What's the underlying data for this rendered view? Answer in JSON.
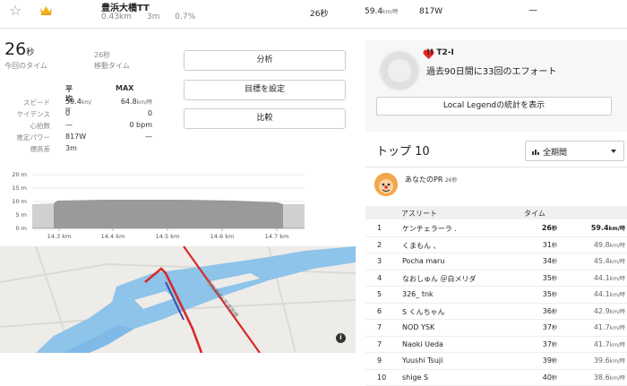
{
  "segment": {
    "name": "豊浜大橋TT",
    "distance": "0.43km",
    "elevation": "3m",
    "grade": "0.7%",
    "time": "26秒",
    "speed_value": "59.4",
    "speed_unit": "km/時",
    "power": "817W",
    "dash": "—"
  },
  "summary": {
    "time_value": "26",
    "time_unit": "秒",
    "time_label": "今回のタイム",
    "moving_time": "26秒",
    "moving_label": "移動タイム"
  },
  "stats": {
    "header_avg": "平均",
    "header_max": "MAX",
    "rows": [
      {
        "label": "スピード",
        "avg": "59.4km/時",
        "max": "64.8km/時"
      },
      {
        "label": "ケイデンス",
        "avg": "0",
        "max": "0"
      },
      {
        "label": "心拍数",
        "avg": "—",
        "max": "0 bpm"
      },
      {
        "label": "推定パワー",
        "avg": "817W",
        "max": "—"
      },
      {
        "label": "標高差",
        "avg": "3m",
        "max": ""
      }
    ]
  },
  "buttons": {
    "analyze": "分析",
    "set_goal": "目標を設定",
    "compare": "比較"
  },
  "elevation_chart": {
    "y_ticks": [
      "20 m",
      "15 m",
      "10 m",
      "5 m",
      "0 m"
    ],
    "x_ticks": [
      "14.3 km",
      "14.4 km",
      "14.5 km",
      "14.6 km",
      "14.7 km"
    ]
  },
  "map": {
    "info_icon": "info-icon",
    "road_label": "阪神高速5号湾岸線"
  },
  "local_legend": {
    "name": "!! T2-I",
    "efforts": "過去90日間に33回のエフォート",
    "stats_button": "Local Legendの統計を表示"
  },
  "leaderboard": {
    "title": "トップ 10",
    "period": "全期間",
    "pr_label": "あなたのPR",
    "pr_time": "26秒",
    "header_athlete": "アスリート",
    "header_time": "タイム",
    "rows": [
      {
        "rank": "1",
        "name": "ケンチェラーラ .",
        "time": "26",
        "unit": "秒",
        "speed": "59.4",
        "speed_unit": "km/時"
      },
      {
        "rank": "2",
        "name": "くまもん 、",
        "time": "31",
        "unit": "秒",
        "speed": "49.8",
        "speed_unit": "km/時"
      },
      {
        "rank": "3",
        "name": "Pocha maru",
        "time": "34",
        "unit": "秒",
        "speed": "45.4",
        "speed_unit": "km/時"
      },
      {
        "rank": "4",
        "name": "なおしゅん ＠白メリダ",
        "time": "35",
        "unit": "秒",
        "speed": "44.1",
        "speed_unit": "km/時"
      },
      {
        "rank": "5",
        "name": "326_ tnk",
        "time": "35",
        "unit": "秒",
        "speed": "44.1",
        "speed_unit": "km/時"
      },
      {
        "rank": "6",
        "name": "S くんちゃん",
        "time": "36",
        "unit": "秒",
        "speed": "42.9",
        "speed_unit": "km/時"
      },
      {
        "rank": "7",
        "name": "NOD YSK",
        "time": "37",
        "unit": "秒",
        "speed": "41.7",
        "speed_unit": "km/時"
      },
      {
        "rank": "7",
        "name": "Naoki Ueda",
        "time": "37",
        "unit": "秒",
        "speed": "41.7",
        "speed_unit": "km/時"
      },
      {
        "rank": "9",
        "name": "Yuushi Tsuji",
        "time": "39",
        "unit": "秒",
        "speed": "39.6",
        "speed_unit": "km/時"
      },
      {
        "rank": "10",
        "name": "shige S",
        "time": "40",
        "unit": "秒",
        "speed": "38.6",
        "speed_unit": "km/時"
      }
    ]
  },
  "colors": {
    "route": "#d62a2a",
    "water": "#8ec3ea",
    "elevation_fill": "#b5b5b5",
    "crown": "#f2b01e"
  }
}
